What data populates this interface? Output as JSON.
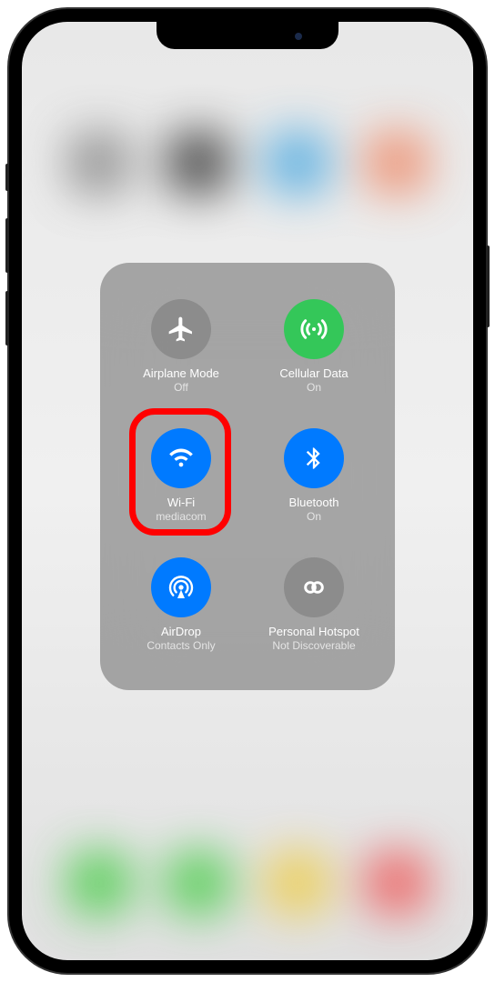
{
  "controls": {
    "airplane": {
      "label": "Airplane Mode",
      "status": "Off"
    },
    "cellular": {
      "label": "Cellular Data",
      "status": "On"
    },
    "wifi": {
      "label": "Wi-Fi",
      "status": "mediacom"
    },
    "bluetooth": {
      "label": "Bluetooth",
      "status": "On"
    },
    "airdrop": {
      "label": "AirDrop",
      "status": "Contacts Only"
    },
    "hotspot": {
      "label": "Personal Hotspot",
      "status": "Not Discoverable"
    }
  },
  "colors": {
    "active_blue": "#007aff",
    "active_green": "#34c759",
    "inactive_grey": "rgba(130,130,130,0.7)",
    "highlight": "#ff0000"
  }
}
